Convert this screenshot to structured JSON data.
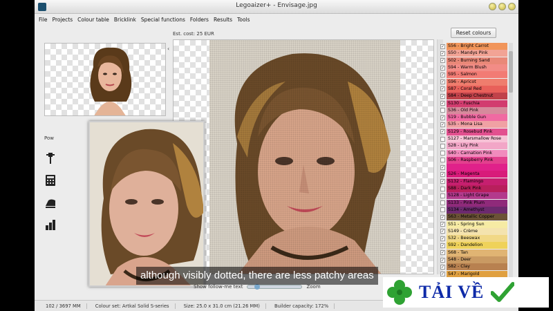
{
  "window": {
    "title": "Legoaizer+  -  Envisage.jpg"
  },
  "menu": [
    "File",
    "Projects",
    "Colour table",
    "Bricklink",
    "Special functions",
    "Folders",
    "Results",
    "Tools"
  ],
  "toolbar": {
    "est_cost": "Est. cost:  25 EUR",
    "reset_label": "Reset colours",
    "power_label": "Pow"
  },
  "colours": [
    {
      "code": "S56 - Bright Carrot",
      "hex": "#f1955a",
      "checked": true
    },
    {
      "code": "S50 - Mandys Pink",
      "hex": "#f2a395",
      "checked": true
    },
    {
      "code": "S02 - Burning Sand",
      "hex": "#e98878",
      "checked": true
    },
    {
      "code": "S94 - Warm Blush",
      "hex": "#f28c86",
      "checked": true
    },
    {
      "code": "S95 - Salmon",
      "hex": "#f27b74",
      "checked": true
    },
    {
      "code": "S96 - Apricot",
      "hex": "#ef7d6d",
      "checked": true
    },
    {
      "code": "S87 - Coral Red",
      "hex": "#e8605a",
      "checked": true
    },
    {
      "code": "S84 - Deep Chestnut",
      "hex": "#c0424a",
      "checked": true
    },
    {
      "code": "S130 - Fuschia",
      "hex": "#d23c6f",
      "checked": true
    },
    {
      "code": "S36 - Old Pink",
      "hex": "#d68a9c",
      "checked": false
    },
    {
      "code": "S19 - Bubble Gun",
      "hex": "#f06aa2",
      "checked": true
    },
    {
      "code": "S35 - Mona Lisa",
      "hex": "#f0a1a4",
      "checked": true
    },
    {
      "code": "S129 - Rosebud Pink",
      "hex": "#e2508f",
      "checked": true
    },
    {
      "code": "S127 - Marsmallow Rose",
      "hex": "#f7c2d6",
      "checked": false
    },
    {
      "code": "S28 - Lily Pink",
      "hex": "#f2a6c7",
      "checked": false
    },
    {
      "code": "S40 - Carnation Pink",
      "hex": "#f18bbd",
      "checked": false
    },
    {
      "code": "S06 - Raspberry Pink",
      "hex": "#e3408e",
      "checked": false
    },
    {
      "code": "",
      "hex": "#e0218a",
      "checked": true
    },
    {
      "code": "S26 - Magenta",
      "hex": "#d81b7a",
      "checked": true
    },
    {
      "code": "S132 - Flamingo",
      "hex": "#c61f6f",
      "checked": true
    },
    {
      "code": "S88 - Dark Pink",
      "hex": "#b81f5c",
      "checked": false
    },
    {
      "code": "S128 - Light Grape",
      "hex": "#b33a8c",
      "checked": false
    },
    {
      "code": "S133 - Pink Plum",
      "hex": "#8f2a7a",
      "checked": false
    },
    {
      "code": "S134 - Amethyst",
      "hex": "#6c2a6e",
      "checked": false
    },
    {
      "code": "S63 - Metallic Copper",
      "hex": "#6b5236",
      "checked": true
    },
    {
      "code": "S51 - Spring Sun",
      "hex": "#f6eba4",
      "checked": true
    },
    {
      "code": "S149 - Crème",
      "hex": "#f4e3ae",
      "checked": true
    },
    {
      "code": "S32 - Beeswax",
      "hex": "#f1d886",
      "checked": true
    },
    {
      "code": "S92 - Dandelion",
      "hex": "#efd25a",
      "checked": true
    },
    {
      "code": "S68 - Tan",
      "hex": "#e0b473",
      "checked": true
    },
    {
      "code": "S48 - Deer",
      "hex": "#c99a63",
      "checked": true
    },
    {
      "code": "S82 - Clay",
      "hex": "#b88150",
      "checked": true
    },
    {
      "code": "S47 - Marigold",
      "hex": "#e0a040",
      "checked": true
    }
  ],
  "bottom": {
    "follow_text": "Show follow-me text",
    "zoom_label": "Zoom"
  },
  "status": {
    "count": "102 / 3697 MM",
    "colour_set": "Colour set: Artkal Solid S-series",
    "size": "Size: 25.0 x 31.0 cm (21.26 MM)",
    "capacity": "Builder capacity: 172%"
  },
  "subtitle": "although visibly dotted, there are less patchy areas",
  "watermark": {
    "text": "TẢI VỀ"
  }
}
